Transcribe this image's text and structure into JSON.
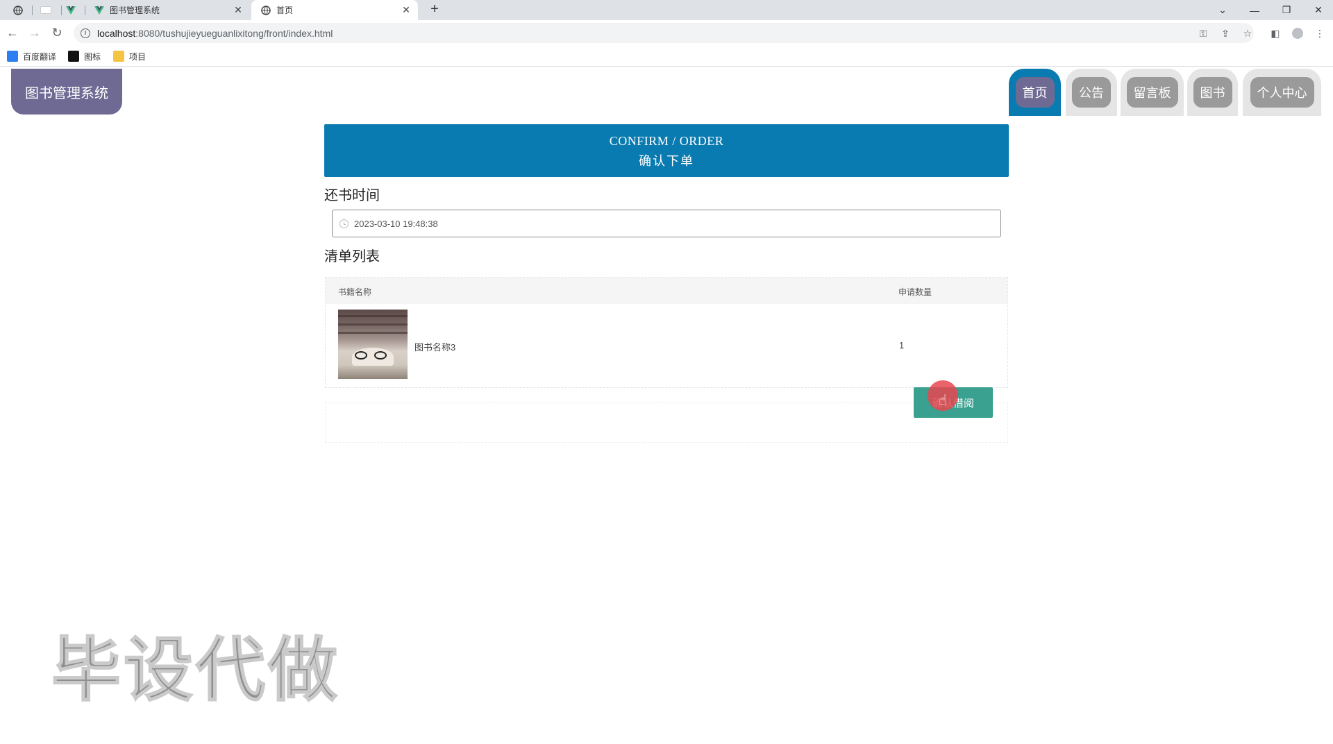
{
  "browser": {
    "tabs": [
      {
        "label": "图书管理系统",
        "type": "vue"
      },
      {
        "label": "首页",
        "type": "globe",
        "active": true
      }
    ],
    "url_host": "localhost",
    "url_rest": ":8080/tushujieyueguanlixitong/front/index.html",
    "bookmarks": [
      {
        "label": "百度翻译",
        "color": "#2d7ef2"
      },
      {
        "label": "图标",
        "color": "#111111"
      },
      {
        "label": "项目",
        "color": "#f5c443"
      }
    ]
  },
  "header": {
    "logo": "图书管理系统",
    "nav": [
      "首页",
      "公告",
      "留言板",
      "图书",
      "个人中心"
    ]
  },
  "banner": {
    "en": "CONFIRM / ORDER",
    "cn": "确认下单"
  },
  "form": {
    "return_time_label": "还书时间",
    "return_time_value": "2023-03-10 19:48:38"
  },
  "list": {
    "title": "清单列表",
    "columns": [
      "书籍名称",
      "申请数量"
    ],
    "rows": [
      {
        "name": "图书名称3",
        "qty": "1"
      }
    ]
  },
  "actions": {
    "confirm_label": "确认借阅"
  },
  "watermark": "毕设代做",
  "colors": {
    "primary": "#0a7bb0",
    "logo_bg": "#6e6a94",
    "confirm": "#3aa08f"
  }
}
